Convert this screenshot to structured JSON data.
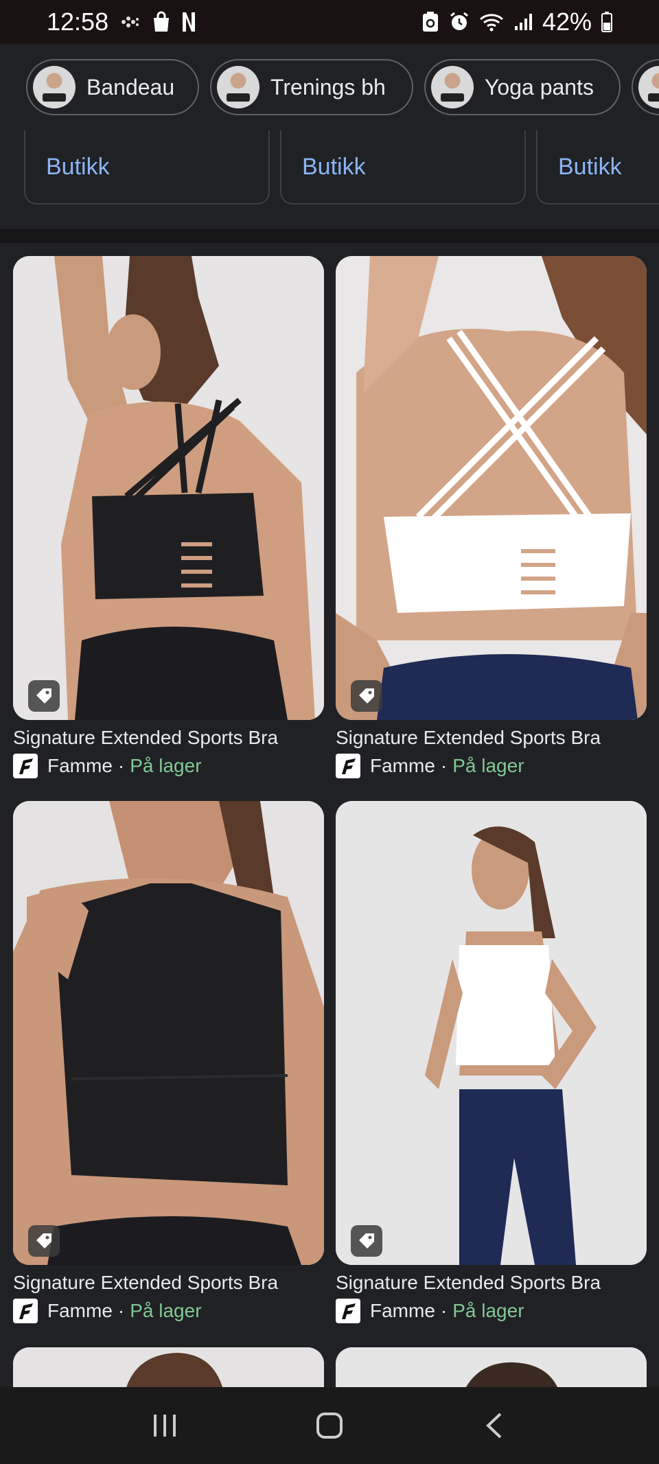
{
  "status_bar": {
    "time": "12:58",
    "battery": "42%",
    "icons": [
      "hand-wave-icon",
      "shopping-bag-icon",
      "netflix-n-icon",
      "recycle-icon",
      "alarm-icon",
      "wifi-icon",
      "signal-icon",
      "battery-icon"
    ]
  },
  "chips": [
    {
      "label": "Bandeau"
    },
    {
      "label": "Trenings bh"
    },
    {
      "label": "Yoga pants"
    },
    {
      "label": ""
    }
  ],
  "stores": [
    {
      "label": "Butikk"
    },
    {
      "label": "Butikk"
    },
    {
      "label": "Butikk"
    }
  ],
  "products": [
    {
      "title": "Signature Extended Sports Bra",
      "store": "Famme",
      "separator": "·",
      "stock": "På lager",
      "color": "#1f1f22"
    },
    {
      "title": "Signature Extended Sports Bra",
      "store": "Famme",
      "separator": "·",
      "stock": "På lager",
      "color": "#ffffff"
    },
    {
      "title": "Signature Extended Sports Bra",
      "store": "Famme",
      "separator": "·",
      "stock": "På lager",
      "color": "#1f1f22"
    },
    {
      "title": "Signature Extended Sports Bra",
      "store": "Famme",
      "separator": "·",
      "stock": "På lager",
      "color": "#ffffff"
    }
  ],
  "colors": {
    "background": "#202124",
    "link": "#8ab4f8",
    "in_stock": "#81c995",
    "text": "#e8eaed"
  },
  "nav_bar": {
    "icons": [
      "recent-apps-icon",
      "home-icon",
      "back-icon"
    ]
  }
}
